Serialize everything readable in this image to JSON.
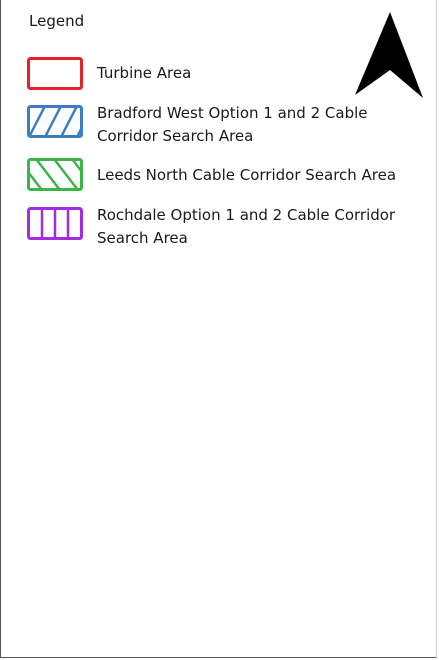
{
  "legend": {
    "title": "Legend",
    "items": [
      {
        "label": "Turbine Area",
        "color": "#e3242b",
        "pattern": "none"
      },
      {
        "label": "Bradford West Option 1 and 2 Cable Corridor Search Area",
        "color": "#3a7fc1",
        "pattern": "forward-diagonal-hatch"
      },
      {
        "label": "Leeds North Cable Corridor Search Area",
        "color": "#3db34a",
        "pattern": "backward-diagonal-hatch"
      },
      {
        "label": "Rochdale Option 1 and 2 Cable Corridor Search Area",
        "color": "#a52be0",
        "pattern": "vertical-lines"
      }
    ]
  },
  "north_arrow": {
    "icon": "north-arrow-icon",
    "color": "#000000"
  }
}
